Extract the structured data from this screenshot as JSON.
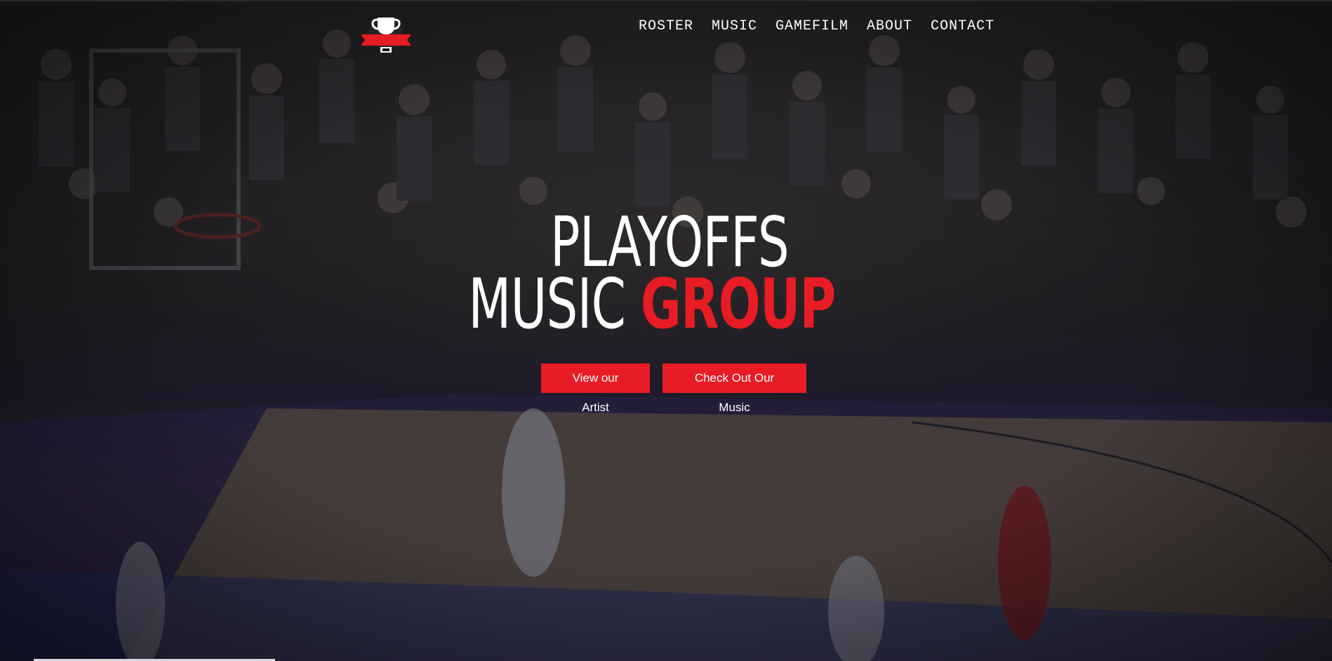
{
  "nav": {
    "items": [
      {
        "label": "ROSTER"
      },
      {
        "label": "MUSIC"
      },
      {
        "label": "GAMEFILM"
      },
      {
        "label": "ABOUT"
      },
      {
        "label": "CONTACT"
      }
    ]
  },
  "hero": {
    "line1": "PLAYOFFS",
    "line2_part1": "MUSIC ",
    "line2_accent": "GROUP"
  },
  "buttons": {
    "view_artist": "View our Artist",
    "check_music": "Check Out Our Music"
  },
  "colors": {
    "accent": "#e81c24",
    "text": "#ffffff"
  },
  "icons": {
    "logo": "trophy-icon"
  }
}
